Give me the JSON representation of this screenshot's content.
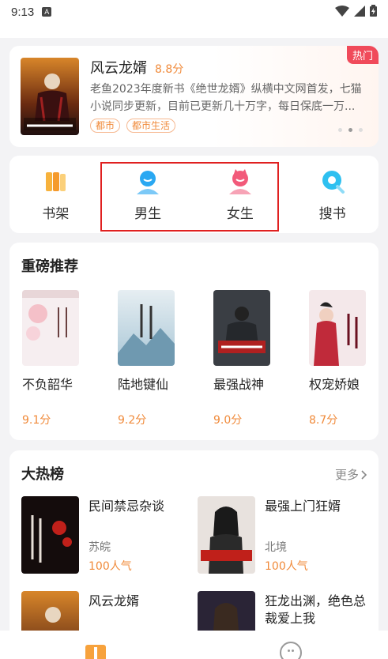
{
  "status_bar": {
    "time": "9:13",
    "notif_glyph": "A"
  },
  "banner": {
    "title": "风云龙婿",
    "score": "8.8分",
    "description": "老鱼2023年度新书《绝世龙婿》纵横中文网首发，七猫小说同步更新，目前已更新几十万字，每日保底一万...",
    "tags": [
      "都市",
      "都市生活"
    ],
    "badge": "热门"
  },
  "nav": {
    "items": [
      {
        "label": "书架",
        "icon": "bookshelf-icon"
      },
      {
        "label": "男生",
        "icon": "male-icon"
      },
      {
        "label": "女生",
        "icon": "female-icon"
      },
      {
        "label": "搜书",
        "icon": "search-icon"
      }
    ]
  },
  "recommend": {
    "title": "重磅推荐",
    "books": [
      {
        "name": "不负韶华",
        "score": "9.1分"
      },
      {
        "name": "陆地键仙",
        "score": "9.2分"
      },
      {
        "name": "最强战神",
        "score": "9.0分"
      },
      {
        "name": "权宠娇娘",
        "score": "8.7分"
      }
    ]
  },
  "hot_list": {
    "title": "大热榜",
    "more": "更多",
    "books": [
      {
        "name": "民间禁忌杂谈",
        "author": "苏皖",
        "popularity": "100人气"
      },
      {
        "name": "最强上门狂婿",
        "author": "北境",
        "popularity": "100人气"
      },
      {
        "name": "风云龙婿",
        "author": "",
        "popularity": ""
      },
      {
        "name": "狂龙出渊，绝色总裁爱上我",
        "author": "",
        "popularity": ""
      }
    ]
  },
  "colors": {
    "accent": "#f08a3a",
    "hot_badge": "#f04a5a",
    "highlight": "#e02020"
  }
}
